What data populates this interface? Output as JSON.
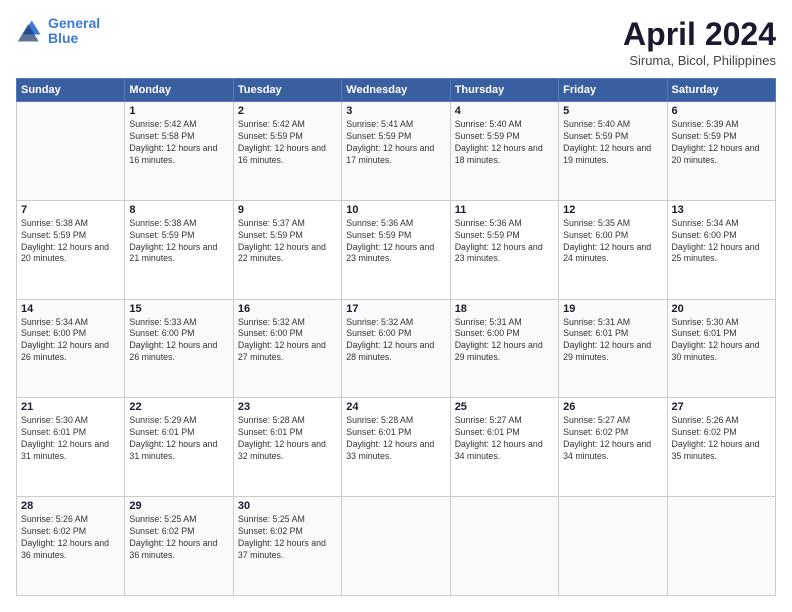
{
  "logo": {
    "line1": "General",
    "line2": "Blue"
  },
  "title": "April 2024",
  "location": "Siruma, Bicol, Philippines",
  "days_of_week": [
    "Sunday",
    "Monday",
    "Tuesday",
    "Wednesday",
    "Thursday",
    "Friday",
    "Saturday"
  ],
  "weeks": [
    [
      {
        "day": "",
        "sunrise": "",
        "sunset": "",
        "daylight": ""
      },
      {
        "day": "1",
        "sunrise": "Sunrise: 5:42 AM",
        "sunset": "Sunset: 5:58 PM",
        "daylight": "Daylight: 12 hours and 16 minutes."
      },
      {
        "day": "2",
        "sunrise": "Sunrise: 5:42 AM",
        "sunset": "Sunset: 5:59 PM",
        "daylight": "Daylight: 12 hours and 16 minutes."
      },
      {
        "day": "3",
        "sunrise": "Sunrise: 5:41 AM",
        "sunset": "Sunset: 5:59 PM",
        "daylight": "Daylight: 12 hours and 17 minutes."
      },
      {
        "day": "4",
        "sunrise": "Sunrise: 5:40 AM",
        "sunset": "Sunset: 5:59 PM",
        "daylight": "Daylight: 12 hours and 18 minutes."
      },
      {
        "day": "5",
        "sunrise": "Sunrise: 5:40 AM",
        "sunset": "Sunset: 5:59 PM",
        "daylight": "Daylight: 12 hours and 19 minutes."
      },
      {
        "day": "6",
        "sunrise": "Sunrise: 5:39 AM",
        "sunset": "Sunset: 5:59 PM",
        "daylight": "Daylight: 12 hours and 20 minutes."
      }
    ],
    [
      {
        "day": "7",
        "sunrise": "Sunrise: 5:38 AM",
        "sunset": "Sunset: 5:59 PM",
        "daylight": "Daylight: 12 hours and 20 minutes."
      },
      {
        "day": "8",
        "sunrise": "Sunrise: 5:38 AM",
        "sunset": "Sunset: 5:59 PM",
        "daylight": "Daylight: 12 hours and 21 minutes."
      },
      {
        "day": "9",
        "sunrise": "Sunrise: 5:37 AM",
        "sunset": "Sunset: 5:59 PM",
        "daylight": "Daylight: 12 hours and 22 minutes."
      },
      {
        "day": "10",
        "sunrise": "Sunrise: 5:36 AM",
        "sunset": "Sunset: 5:59 PM",
        "daylight": "Daylight: 12 hours and 23 minutes."
      },
      {
        "day": "11",
        "sunrise": "Sunrise: 5:36 AM",
        "sunset": "Sunset: 5:59 PM",
        "daylight": "Daylight: 12 hours and 23 minutes."
      },
      {
        "day": "12",
        "sunrise": "Sunrise: 5:35 AM",
        "sunset": "Sunset: 6:00 PM",
        "daylight": "Daylight: 12 hours and 24 minutes."
      },
      {
        "day": "13",
        "sunrise": "Sunrise: 5:34 AM",
        "sunset": "Sunset: 6:00 PM",
        "daylight": "Daylight: 12 hours and 25 minutes."
      }
    ],
    [
      {
        "day": "14",
        "sunrise": "Sunrise: 5:34 AM",
        "sunset": "Sunset: 6:00 PM",
        "daylight": "Daylight: 12 hours and 26 minutes."
      },
      {
        "day": "15",
        "sunrise": "Sunrise: 5:33 AM",
        "sunset": "Sunset: 6:00 PM",
        "daylight": "Daylight: 12 hours and 26 minutes."
      },
      {
        "day": "16",
        "sunrise": "Sunrise: 5:32 AM",
        "sunset": "Sunset: 6:00 PM",
        "daylight": "Daylight: 12 hours and 27 minutes."
      },
      {
        "day": "17",
        "sunrise": "Sunrise: 5:32 AM",
        "sunset": "Sunset: 6:00 PM",
        "daylight": "Daylight: 12 hours and 28 minutes."
      },
      {
        "day": "18",
        "sunrise": "Sunrise: 5:31 AM",
        "sunset": "Sunset: 6:00 PM",
        "daylight": "Daylight: 12 hours and 29 minutes."
      },
      {
        "day": "19",
        "sunrise": "Sunrise: 5:31 AM",
        "sunset": "Sunset: 6:01 PM",
        "daylight": "Daylight: 12 hours and 29 minutes."
      },
      {
        "day": "20",
        "sunrise": "Sunrise: 5:30 AM",
        "sunset": "Sunset: 6:01 PM",
        "daylight": "Daylight: 12 hours and 30 minutes."
      }
    ],
    [
      {
        "day": "21",
        "sunrise": "Sunrise: 5:30 AM",
        "sunset": "Sunset: 6:01 PM",
        "daylight": "Daylight: 12 hours and 31 minutes."
      },
      {
        "day": "22",
        "sunrise": "Sunrise: 5:29 AM",
        "sunset": "Sunset: 6:01 PM",
        "daylight": "Daylight: 12 hours and 31 minutes."
      },
      {
        "day": "23",
        "sunrise": "Sunrise: 5:28 AM",
        "sunset": "Sunset: 6:01 PM",
        "daylight": "Daylight: 12 hours and 32 minutes."
      },
      {
        "day": "24",
        "sunrise": "Sunrise: 5:28 AM",
        "sunset": "Sunset: 6:01 PM",
        "daylight": "Daylight: 12 hours and 33 minutes."
      },
      {
        "day": "25",
        "sunrise": "Sunrise: 5:27 AM",
        "sunset": "Sunset: 6:01 PM",
        "daylight": "Daylight: 12 hours and 34 minutes."
      },
      {
        "day": "26",
        "sunrise": "Sunrise: 5:27 AM",
        "sunset": "Sunset: 6:02 PM",
        "daylight": "Daylight: 12 hours and 34 minutes."
      },
      {
        "day": "27",
        "sunrise": "Sunrise: 5:26 AM",
        "sunset": "Sunset: 6:02 PM",
        "daylight": "Daylight: 12 hours and 35 minutes."
      }
    ],
    [
      {
        "day": "28",
        "sunrise": "Sunrise: 5:26 AM",
        "sunset": "Sunset: 6:02 PM",
        "daylight": "Daylight: 12 hours and 36 minutes."
      },
      {
        "day": "29",
        "sunrise": "Sunrise: 5:25 AM",
        "sunset": "Sunset: 6:02 PM",
        "daylight": "Daylight: 12 hours and 36 minutes."
      },
      {
        "day": "30",
        "sunrise": "Sunrise: 5:25 AM",
        "sunset": "Sunset: 6:02 PM",
        "daylight": "Daylight: 12 hours and 37 minutes."
      },
      {
        "day": "",
        "sunrise": "",
        "sunset": "",
        "daylight": ""
      },
      {
        "day": "",
        "sunrise": "",
        "sunset": "",
        "daylight": ""
      },
      {
        "day": "",
        "sunrise": "",
        "sunset": "",
        "daylight": ""
      },
      {
        "day": "",
        "sunrise": "",
        "sunset": "",
        "daylight": ""
      }
    ]
  ]
}
